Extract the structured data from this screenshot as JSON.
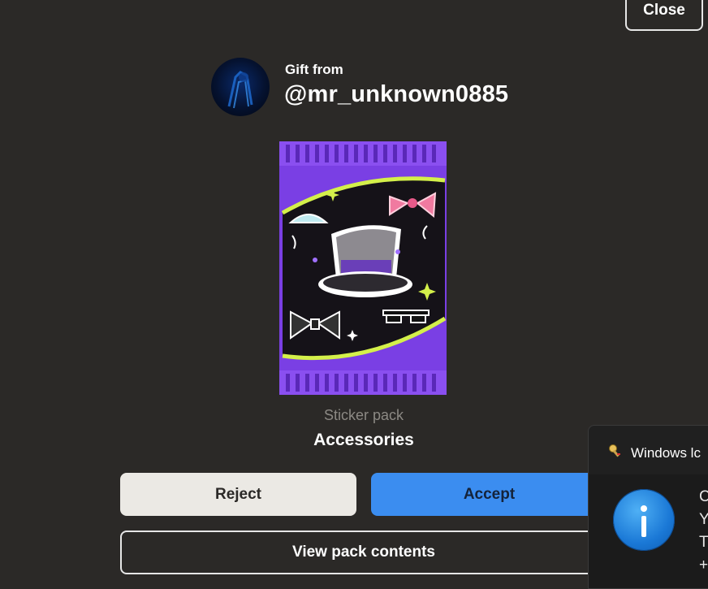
{
  "header": {
    "close_label": "Close"
  },
  "gift": {
    "from_label": "Gift from",
    "username": "@mr_unknown0885"
  },
  "pack": {
    "type_label": "Sticker pack",
    "name": "Accessories"
  },
  "actions": {
    "reject_label": "Reject",
    "accept_label": "Accept",
    "view_label": "View pack contents"
  },
  "toast": {
    "app_name": "Windows lc",
    "lines": [
      "C",
      "Y",
      "T",
      "+"
    ]
  },
  "colors": {
    "background": "#2b2927",
    "accept": "#3b8df0",
    "reject": "#ebe9e4",
    "pack_purple": "#7a3fe4",
    "pack_accent": "#d4f04a"
  }
}
